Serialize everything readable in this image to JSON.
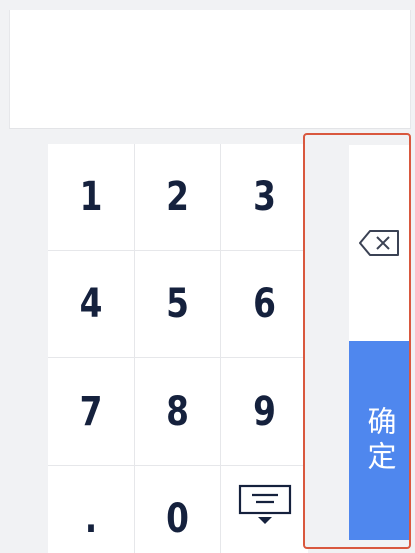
{
  "display": {
    "value": ""
  },
  "keypad": {
    "keys": [
      "1",
      "2",
      "3",
      "4",
      "5",
      "6",
      "7",
      "8",
      "9",
      ".",
      "0"
    ],
    "hide_icon": "keyboard-hide-icon"
  },
  "side": {
    "backspace_icon": "backspace-icon",
    "confirm_label": "确定"
  },
  "colors": {
    "background": "#f1f2f4",
    "key_text": "#15213d",
    "confirm_bg": "#4f87ee",
    "highlight_border": "#d9583e"
  }
}
